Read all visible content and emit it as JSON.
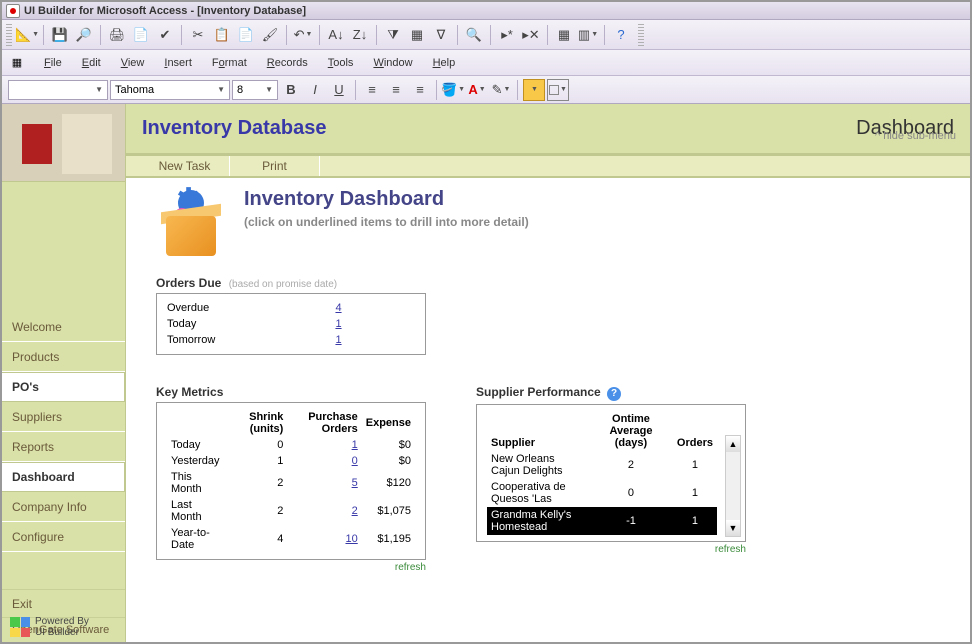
{
  "window": {
    "title": "UI Builder for Microsoft Access - [Inventory Database]"
  },
  "menus": [
    "File",
    "Edit",
    "View",
    "Insert",
    "Format",
    "Records",
    "Tools",
    "Window",
    "Help"
  ],
  "font": {
    "name": "Tahoma",
    "size": "8"
  },
  "header": {
    "dbtitle": "Inventory Database",
    "pagetitle": "Dashboard"
  },
  "tabs": {
    "newtask": "New Task",
    "print": "Print"
  },
  "hidelink": "hide sub-menu",
  "nav": {
    "items": [
      {
        "label": "Welcome",
        "active": false
      },
      {
        "label": "Products",
        "active": false
      },
      {
        "label": "PO's",
        "active": true
      },
      {
        "label": "Suppliers",
        "active": false
      },
      {
        "label": "Reports",
        "active": false
      },
      {
        "label": "Dashboard",
        "active": true
      },
      {
        "label": "Company Info",
        "active": false
      },
      {
        "label": "Configure",
        "active": false
      }
    ],
    "exit": "Exit",
    "footer": "OpenGate Software"
  },
  "dash": {
    "title": "Inventory Dashboard",
    "subtitle": "(click on underlined items to drill into more detail)"
  },
  "orders_due": {
    "title": "Orders Due",
    "note": "(based on promise date)",
    "rows": [
      {
        "label": "Overdue",
        "value": "4"
      },
      {
        "label": "Today",
        "value": "1"
      },
      {
        "label": "Tomorrow",
        "value": "1"
      }
    ]
  },
  "key_metrics": {
    "title": "Key Metrics",
    "headers": {
      "period": "",
      "shrink": "Shrink (units)",
      "po": "Purchase Orders",
      "expense": "Expense"
    },
    "rows": [
      {
        "period": "Today",
        "shrink": "0",
        "po": "1",
        "expense": "$0"
      },
      {
        "period": "Yesterday",
        "shrink": "1",
        "po": "0",
        "expense": "$0"
      },
      {
        "period": "This Month",
        "shrink": "2",
        "po": "5",
        "expense": "$120"
      },
      {
        "period": "Last Month",
        "shrink": "2",
        "po": "2",
        "expense": "$1,075"
      },
      {
        "period": "Year-to-Date",
        "shrink": "4",
        "po": "10",
        "expense": "$1,195"
      }
    ],
    "refresh": "refresh"
  },
  "supplier_perf": {
    "title": "Supplier Performance",
    "headers": {
      "supplier": "Supplier",
      "ontime": "Ontime Average (days)",
      "orders": "Orders"
    },
    "rows": [
      {
        "supplier": "New Orleans Cajun Delights",
        "ontime": "2",
        "orders": "1",
        "sel": false
      },
      {
        "supplier": "Cooperativa de Quesos 'Las",
        "ontime": "0",
        "orders": "1",
        "sel": false
      },
      {
        "supplier": "Grandma Kelly's Homestead",
        "ontime": "-1",
        "orders": "1",
        "sel": true
      }
    ],
    "refresh": "refresh"
  },
  "powered": {
    "line1": "Powered By",
    "line2": "UI Builder"
  }
}
